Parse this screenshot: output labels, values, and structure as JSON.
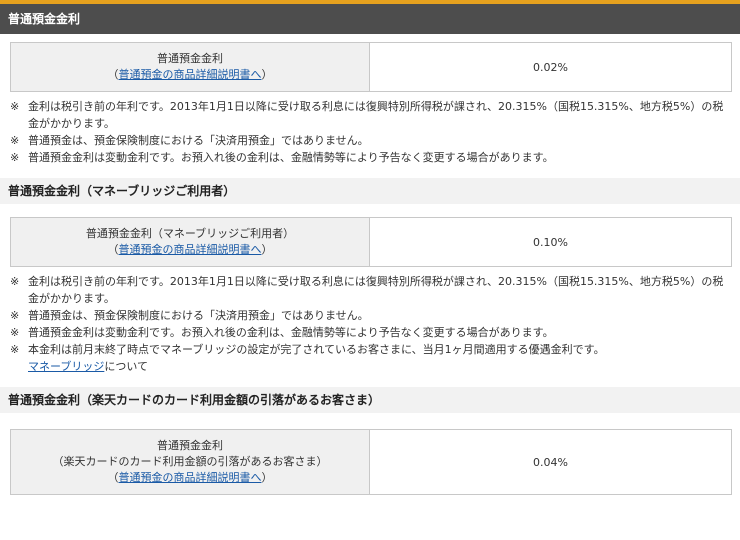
{
  "section1": {
    "header": "普通預金金利",
    "label": "普通預金金利",
    "link_open": "（",
    "link": "普通預金の商品詳細説明書へ",
    "link_close": "）",
    "rate": "0.02%",
    "notes": [
      "金利は税引き前の年利です。2013年1月1日以降に受け取る利息には復興特別所得税が課され、20.315%（国税15.315%、地方税5%）の税金がかかります。",
      "普通預金は、預金保険制度における「決済用預金」ではありません。",
      "普通預金金利は変動金利です。お預入れ後の金利は、金融情勢等により予告なく変更する場合があります。"
    ]
  },
  "section2": {
    "header": "普通預金金利（マネーブリッジご利用者）",
    "label": "普通預金金利（マネーブリッジご利用者）",
    "link_open": "（",
    "link": "普通預金の商品詳細説明書へ",
    "link_close": "）",
    "rate": "0.10%",
    "notes": [
      "金利は税引き前の年利です。2013年1月1日以降に受け取る利息には復興特別所得税が課され、20.315%（国税15.315%、地方税5%）の税金がかかります。",
      "普通預金は、預金保険制度における「決済用預金」ではありません。",
      "普通預金金利は変動金利です。お預入れ後の金利は、金融情勢等により予告なく変更する場合があります。",
      "本金利は前月末終了時点でマネーブリッジの設定が完了されているお客さまに、当月1ヶ月間適用する優遇金利です。"
    ],
    "mb_link": "マネーブリッジ",
    "mb_suffix": "について"
  },
  "section3": {
    "header": "普通預金金利（楽天カードのカード利用金額の引落があるお客さま）",
    "label": "普通預金金利",
    "label2": "（楽天カードのカード利用金額の引落があるお客さま）",
    "link_open": "（",
    "link": "普通預金の商品詳細説明書へ",
    "link_close": "）",
    "rate": "0.04%"
  },
  "note_mark": "※"
}
